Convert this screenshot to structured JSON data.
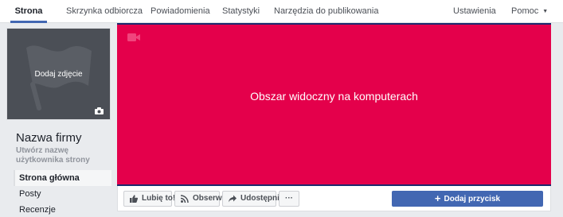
{
  "topnav": {
    "tabs": [
      {
        "label": "Strona",
        "active": true
      },
      {
        "label": "Skrzynka odbiorcza"
      },
      {
        "label": "Powiadomienia"
      },
      {
        "label": "Statystyki"
      },
      {
        "label": "Narzędzia do publikowania"
      }
    ],
    "settings_label": "Ustawienia",
    "help_label": "Pomoc",
    "help_icon": "caret-down-icon"
  },
  "profile": {
    "add_photo_label": "Dodaj zdjęcie",
    "placeholder_icon": "flag-icon",
    "camera_icon": "camera-icon",
    "page_name": "Nazwa firmy",
    "username_prompt": "Utwórz nazwę użytkownika strony"
  },
  "sidenav": {
    "items": [
      {
        "label": "Strona główna",
        "active": true
      },
      {
        "label": "Posty"
      },
      {
        "label": "Recenzje"
      }
    ]
  },
  "cover": {
    "label": "Obszar widoczny na komputerach",
    "background": "#e4004b",
    "border_color": "#1c2a6e",
    "video_icon": "video-camera-icon"
  },
  "actions": {
    "like_label": "Lubię to!",
    "follow_label": "Obserwuj",
    "share_label": "Udostępnij",
    "more_label": "···",
    "primary_label": "Dodaj przycisk",
    "primary_color": "#4267b2"
  }
}
